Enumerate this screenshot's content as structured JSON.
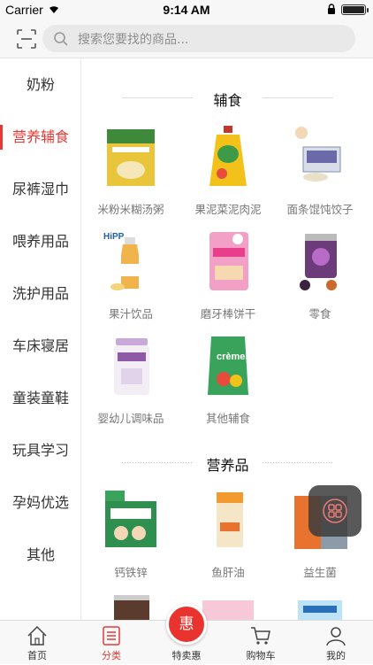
{
  "status_bar": {
    "carrier": "Carrier",
    "time": "9:14 AM"
  },
  "search": {
    "placeholder": "搜索您要找的商品..."
  },
  "sidebar": {
    "items": [
      {
        "label": "奶粉"
      },
      {
        "label": "营养辅食",
        "active": true
      },
      {
        "label": "尿裤湿巾"
      },
      {
        "label": "喂养用品"
      },
      {
        "label": "洗护用品"
      },
      {
        "label": "车床寝居"
      },
      {
        "label": "童装童鞋"
      },
      {
        "label": "玩具学习"
      },
      {
        "label": "孕妈优选"
      },
      {
        "label": "其他"
      }
    ]
  },
  "sections": [
    {
      "title": "辅食",
      "products": [
        {
          "name": "米粉米糊汤粥",
          "icon": "rice-cereal-box"
        },
        {
          "name": "果泥菜泥肉泥",
          "icon": "puree-pouch"
        },
        {
          "name": "面条馄饨饺子",
          "icon": "noodle-box"
        },
        {
          "name": "果汁饮品",
          "icon": "juice-bottle"
        },
        {
          "name": "磨牙棒饼干",
          "icon": "teething-biscuit-bag"
        },
        {
          "name": "零食",
          "icon": "snack-jar"
        },
        {
          "name": "婴幼儿调味品",
          "icon": "seasoning-can"
        },
        {
          "name": "其他辅食",
          "icon": "cremes-pouch"
        }
      ]
    },
    {
      "title": "营养品",
      "products": [
        {
          "name": "钙铁锌",
          "icon": "calcium-box"
        },
        {
          "name": "鱼肝油",
          "icon": "fish-oil-box"
        },
        {
          "name": "益生菌",
          "icon": "probiotic-box"
        }
      ]
    }
  ],
  "tabbar": {
    "items": [
      {
        "label": "首页",
        "icon": "home-icon"
      },
      {
        "label": "分类",
        "icon": "category-icon",
        "active": true
      },
      {
        "label": "特卖惠",
        "icon": "special-sale-icon",
        "badge": "惠"
      },
      {
        "label": "购物车",
        "icon": "cart-icon"
      },
      {
        "label": "我的",
        "icon": "profile-icon"
      }
    ]
  },
  "colors": {
    "accent": "#e53935",
    "special": "#e8332e"
  }
}
